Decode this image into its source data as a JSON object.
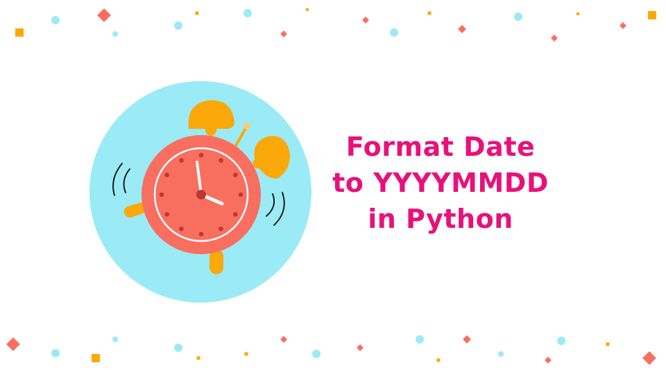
{
  "title": {
    "lines": [
      "Format Date",
      "to YYYYMMDD",
      "in Python"
    ]
  },
  "illustration": {
    "name": "alarm-clock",
    "clock_time": "4:00",
    "colors": {
      "background_circle": "#9AEBF6",
      "clock_body": "#F86F60",
      "bells_and_feet": "#FBA80A",
      "hour_dots": "#C0392B",
      "hands": "#FFFFFF",
      "hub": "#B83A2E",
      "vibration_lines": "#1A1A1A",
      "hammer_tip": "#F9CC6E"
    }
  },
  "colors": {
    "title_text": "#E8117A",
    "confetti_diamond": "#F86F60",
    "confetti_square": "#FBA80A",
    "confetti_circle": "#9AEBF6",
    "page_background": "#FFFFFF"
  }
}
